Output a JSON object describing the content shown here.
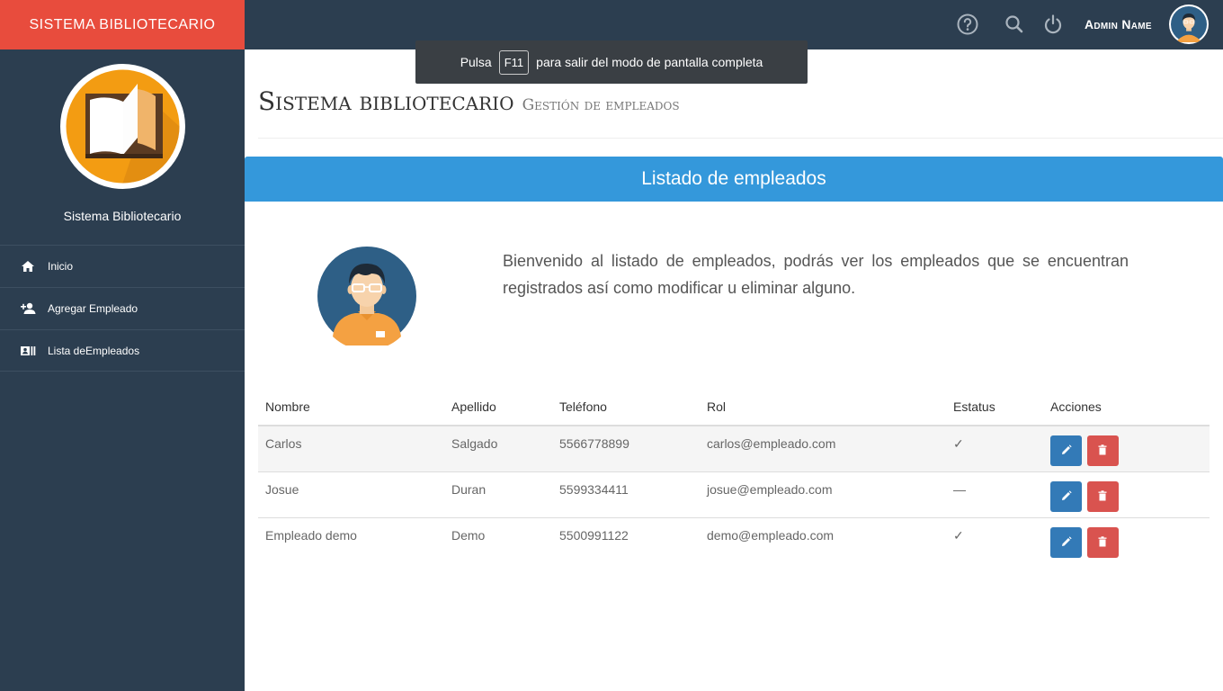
{
  "brand": "SISTEMA BIBLIOTECARIO",
  "topbar": {
    "admin_name": "Admin Name",
    "icons": [
      "help-icon",
      "search-icon",
      "power-icon"
    ]
  },
  "sidebar": {
    "app_name": "Sistema Bibliotecario",
    "items": [
      {
        "label": "Inicio",
        "icon": "home-icon"
      },
      {
        "label": "Agregar Empleado",
        "icon": "add-user-icon"
      },
      {
        "label": "Lista deEmpleados",
        "icon": "id-card-icon"
      }
    ]
  },
  "toast": {
    "prefix": "Pulsa",
    "key": "F11",
    "suffix": "para salir del modo de pantalla completa"
  },
  "header": {
    "title": "Sistema bibliotecario",
    "subtitle": "Gestión de empleados"
  },
  "panel": {
    "title": "Listado de empleados",
    "intro": "Bienvenido al listado de empleados, podrás ver los empleados que se encuentran registrados así como modificar u eliminar alguno."
  },
  "table": {
    "columns": [
      "Nombre",
      "Apellido",
      "Teléfono",
      "Rol",
      "Estatus",
      "Acciones"
    ],
    "rows": [
      {
        "nombre": "Carlos",
        "apellido": "Salgado",
        "telefono": "5566778899",
        "rol": "carlos@empleado.com",
        "estatus": "✓"
      },
      {
        "nombre": "Josue",
        "apellido": "Duran",
        "telefono": "5599334411",
        "rol": "josue@empleado.com",
        "estatus": "—"
      },
      {
        "nombre": "Empleado demo",
        "apellido": "Demo",
        "telefono": "5500991122",
        "rol": "demo@empleado.com",
        "estatus": "✓"
      }
    ]
  },
  "colors": {
    "brand": "#e84c3d",
    "dark": "#2c3e50",
    "panel": "#3498db",
    "edit": "#337ab7",
    "delete": "#d9534f"
  }
}
